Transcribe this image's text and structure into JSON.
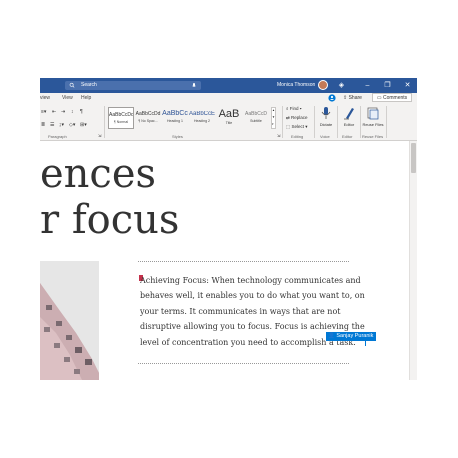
{
  "titlebar": {
    "search_placeholder": "Search",
    "user_name": "Monica Thomson"
  },
  "ribbon": {
    "tabs": [
      "view",
      "View",
      "Help"
    ],
    "share_label": "Share",
    "comments_label": "Comments",
    "styles": [
      {
        "preview": "AaBbCcDd",
        "name": "¶ Normal"
      },
      {
        "preview": "AaBbCcDd",
        "name": "¶ No Spac..."
      },
      {
        "preview": "AaBbCc",
        "name": "Heading 1"
      },
      {
        "preview": "AaBbCcE",
        "name": "Heading 2"
      },
      {
        "preview": "AaB",
        "name": "Title"
      },
      {
        "preview": "AaBbCcD",
        "name": "Subtitle"
      }
    ],
    "find_label": "Find",
    "replace_label": "Replace",
    "select_label": "Select",
    "dictate_label": "Dictate",
    "editor_label": "Editor",
    "reuse_label": "Reuse Files",
    "group_labels": {
      "paragraph": "Paragraph",
      "styles": "Styles",
      "editing": "Editing",
      "voice": "Voice",
      "editor": "Editor",
      "reuse": "Reuse Files"
    }
  },
  "document": {
    "heading_line1": "ences",
    "heading_line2": "r focus",
    "paragraph": "Achieving Focus: When technology communicates and behaves well, it enables you to do what you want to, on your terms. It communicates in ways that are not disruptive allowing you to focus. Focus is achieving the level of concentration you need to accomplish a task.",
    "collaborator_name": "Sanjay Puranik"
  },
  "colors": {
    "titlebar": "#2b579a",
    "accent": "#0078d4",
    "caret": "#c4314b"
  }
}
